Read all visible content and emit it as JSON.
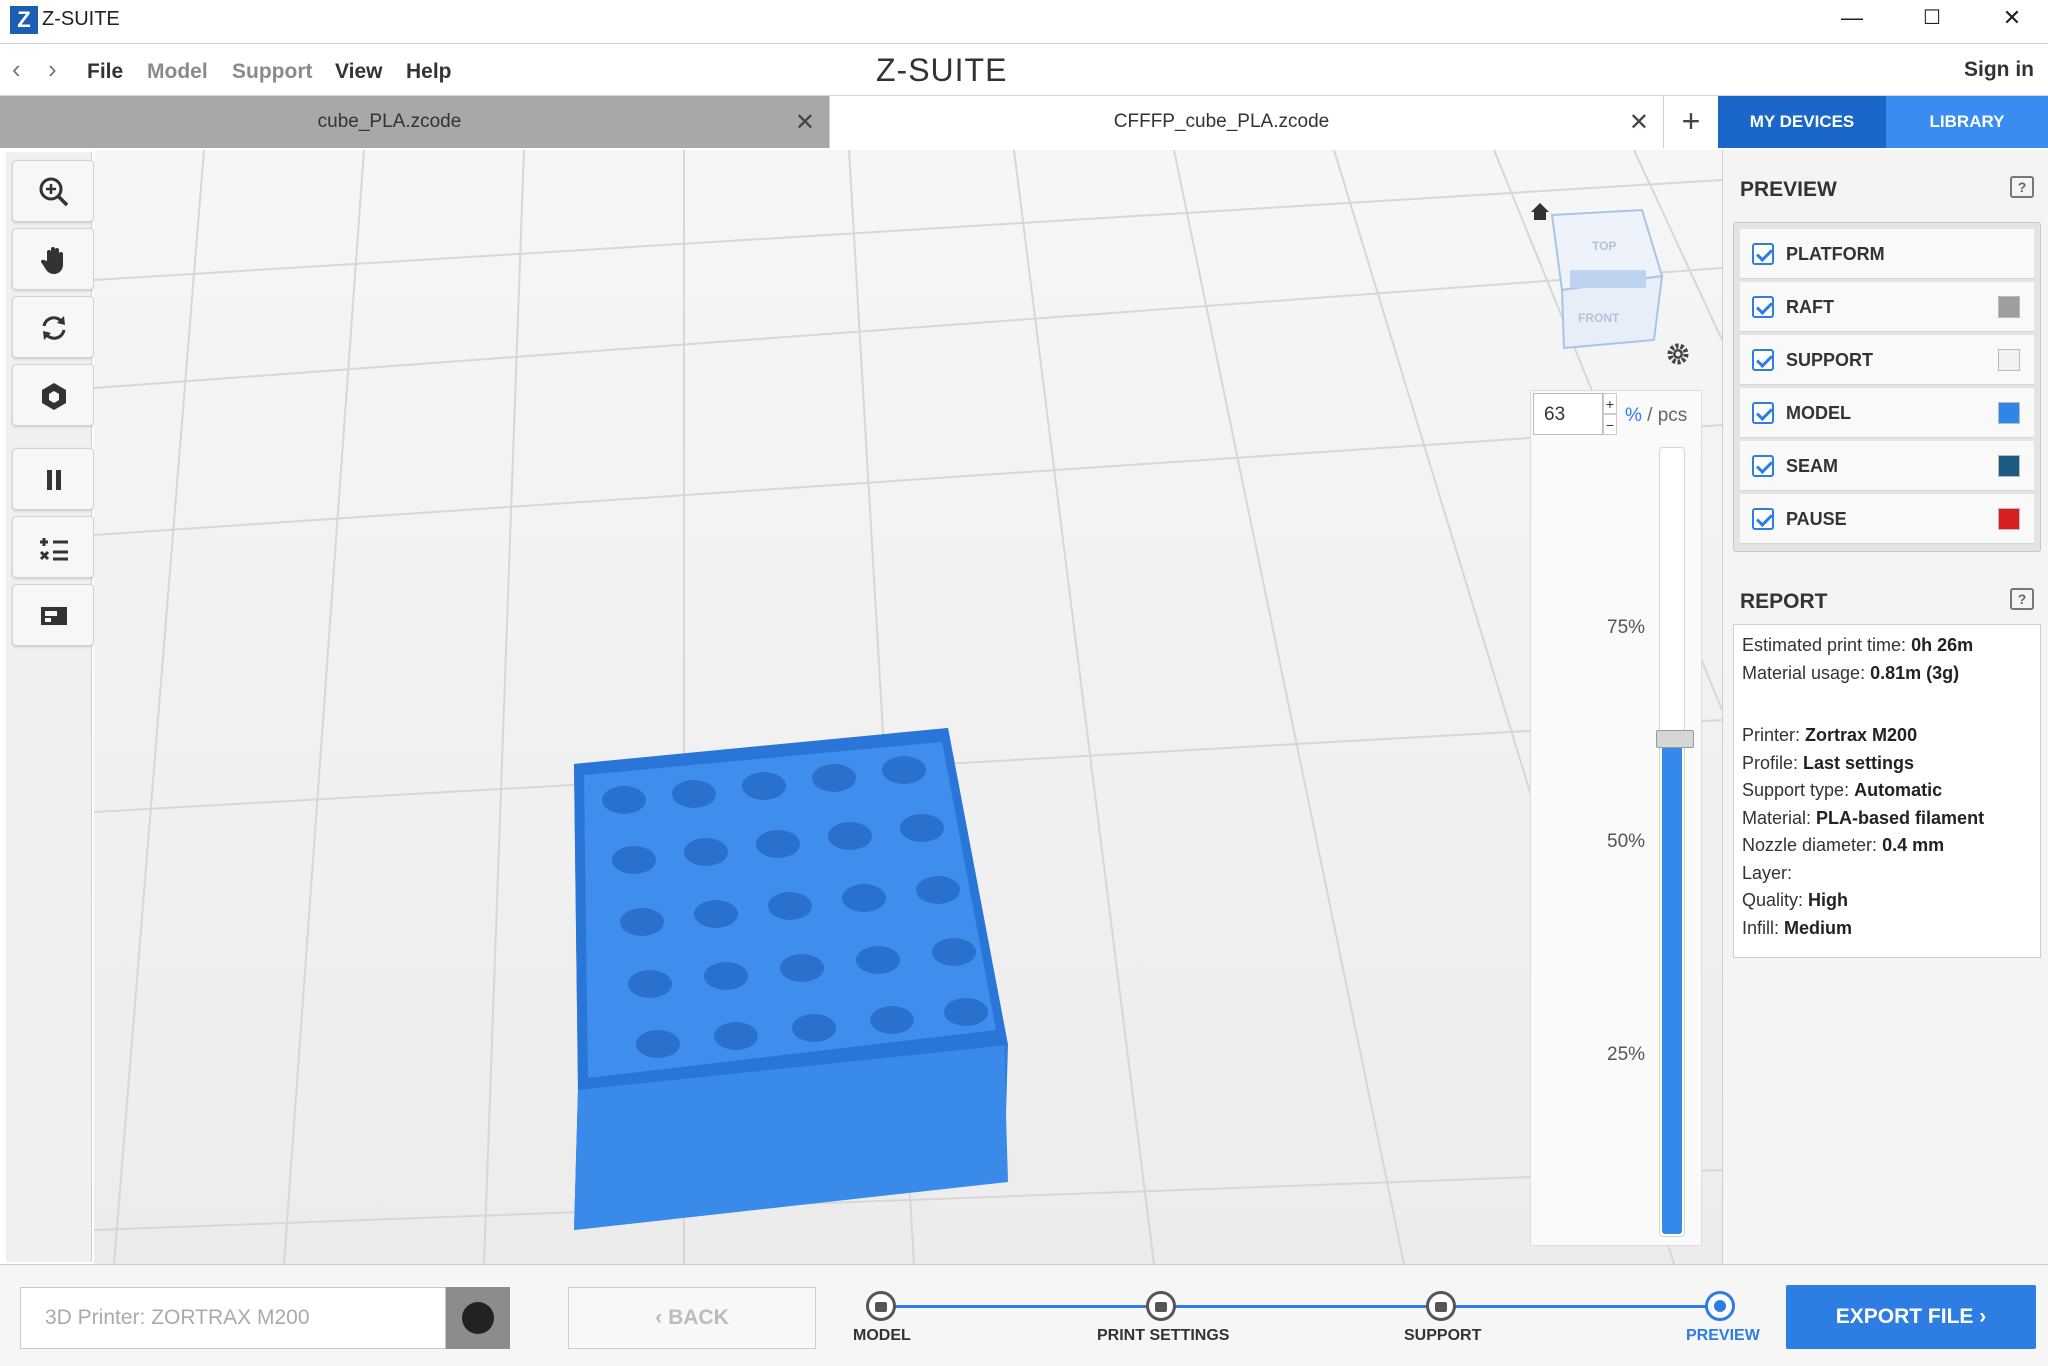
{
  "window": {
    "title": "Z-SUITE",
    "logo_letter": "Z",
    "minimize": "—",
    "maximize": "☐",
    "close": "✕"
  },
  "menu": {
    "back_arrow": "‹",
    "forward_arrow": "›",
    "items": [
      "File",
      "Model",
      "Support",
      "View",
      "Help"
    ],
    "brand": "Z-SUITE",
    "signin": "Sign in"
  },
  "tabs": [
    {
      "label": "cube_PLA.zcode",
      "active": false
    },
    {
      "label": "CFFFP_cube_PLA.zcode",
      "active": true
    }
  ],
  "tab_add": "+",
  "tab_close": "✕",
  "top_buttons": {
    "devices": "MY DEVICES",
    "library": "LIBRARY"
  },
  "tools": [
    "zoom-icon",
    "hand-pan-icon",
    "rotate-icon",
    "cube-view-icon",
    "pause-icon",
    "layer-list-icon",
    "print-layer-icon"
  ],
  "viewcube": {
    "top": "TOP",
    "front": "FRONT"
  },
  "layer_slider": {
    "value": "63",
    "unit_pct": "%",
    "unit_pcs": " / pcs",
    "spin_up": "+",
    "spin_down": "−",
    "labels": [
      "75%",
      "50%",
      "25%"
    ],
    "fill_fraction": 0.63
  },
  "preview": {
    "title": "PREVIEW",
    "help": "?",
    "items": [
      {
        "label": "PLATFORM",
        "checked": true,
        "color": null
      },
      {
        "label": "RAFT",
        "checked": true,
        "color": "#9e9e9e"
      },
      {
        "label": "SUPPORT",
        "checked": true,
        "color": "#f2f2f2"
      },
      {
        "label": "MODEL",
        "checked": true,
        "color": "#2f86ea"
      },
      {
        "label": "SEAM",
        "checked": true,
        "color": "#1c5a85"
      },
      {
        "label": "PAUSE",
        "checked": true,
        "color": "#d81e1e"
      }
    ]
  },
  "report": {
    "title": "REPORT",
    "help": "?",
    "lines": [
      {
        "k": "Estimated print time: ",
        "v": "0h 26m"
      },
      {
        "k": "Material usage: ",
        "v": "0.81m (3g)"
      },
      {
        "k": "",
        "v": ""
      },
      {
        "k": "Printer: ",
        "v": "Zortrax M200"
      },
      {
        "k": "Profile: ",
        "v": "Last settings"
      },
      {
        "k": "Support type: ",
        "v": "Automatic"
      },
      {
        "k": "Material: ",
        "v": "PLA-based filament"
      },
      {
        "k": "Nozzle diameter: ",
        "v": "0.4 mm"
      },
      {
        "k": "Layer:",
        "v": ""
      },
      {
        "k": "Quality: ",
        "v": "High"
      },
      {
        "k": "Infill: ",
        "v": "Medium"
      }
    ]
  },
  "bottom": {
    "printer_placeholder": "3D Printer: ZORTRAX M200",
    "back_label": "‹  BACK",
    "steps": [
      {
        "label": "MODEL",
        "state": "locked"
      },
      {
        "label": "PRINT SETTINGS",
        "state": "locked"
      },
      {
        "label": "SUPPORT",
        "state": "locked"
      },
      {
        "label": "PREVIEW",
        "state": "current"
      }
    ],
    "export_label": "EXPORT FILE  ›"
  },
  "colors": {
    "accent": "#2d7de3",
    "model": "#3589ea",
    "header_blue": "#1a66c9"
  }
}
